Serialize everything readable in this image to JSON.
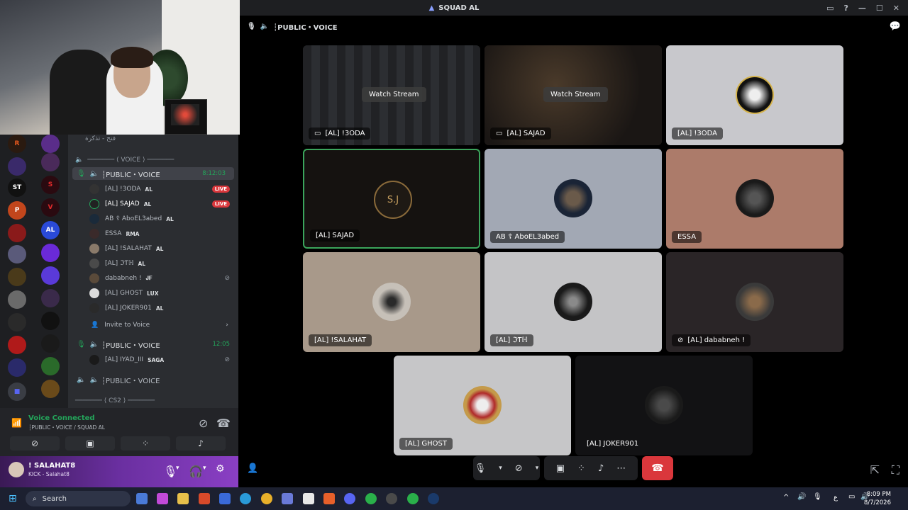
{
  "window": {
    "title": "SQUAD AL"
  },
  "server_rail": {
    "labels": [
      "R",
      "ST",
      "AL"
    ]
  },
  "channels": {
    "top_cut": "فتح - تذكرة",
    "voice_category": "─────── ⟨ VOICE ⟩ ───────",
    "active_channel": "┆PUBLIC・VOICE",
    "active_time": "8:12:03",
    "members": [
      {
        "name": "[AL] !3ODA",
        "tag": "AL",
        "live": "LIVE"
      },
      {
        "name": "[AL] SAJAD",
        "tag": "AL",
        "live": "LIVE"
      },
      {
        "name": "AB ☦ AboEL3abed",
        "tag": "AL",
        "live": ""
      },
      {
        "name": "ESSA",
        "tag": "RMA",
        "live": ""
      },
      {
        "name": "[AL] !SALAHAT",
        "tag": "AL",
        "live": ""
      },
      {
        "name": "[AL] ℑƬℍ",
        "tag": "AL",
        "live": ""
      },
      {
        "name": "dababneh !",
        "tag": "𝐉𝐅",
        "live": ""
      },
      {
        "name": "[AL] GHOST",
        "tag": "LUX",
        "live": ""
      },
      {
        "name": "[AL] JOKER901",
        "tag": "AL",
        "live": ""
      }
    ],
    "invite": "Invite to Voice",
    "channel2": "┆PUBLIC・VOICE",
    "channel2_time": "12:05",
    "channel2_member": "[AL] IYAD_III",
    "channel2_tag": "SAGA",
    "channel3": "┆PUBLIC・VOICE",
    "cs2_category": "─────── ⟨ CS2 ⟩ ───────"
  },
  "voice_panel": {
    "status": "Voice Connected",
    "subtitle": "┆PUBLIC・VOICE / SQUAD AL"
  },
  "user_panel": {
    "name": "! SALAHAT8",
    "status": "KICK - Salahat8"
  },
  "main": {
    "header": "┆PUBLIC・VOICE",
    "tiles": [
      {
        "name": "[AL] !3ODA",
        "watch": "Watch Stream"
      },
      {
        "name": "[AL] SAJAD",
        "watch": "Watch Stream"
      },
      {
        "name": "[AL] !3ODA",
        "watch": ""
      },
      {
        "name": "[AL] SAJAD",
        "watch": ""
      },
      {
        "name": "AB ☦ AboEL3abed",
        "watch": ""
      },
      {
        "name": "ESSA",
        "watch": ""
      },
      {
        "name": "[AL] !SALAHAT",
        "watch": ""
      },
      {
        "name": "[AL] ℑƬℍ",
        "watch": ""
      },
      {
        "name": "[AL] dababneh !",
        "watch": ""
      },
      {
        "name": "[AL] GHOST",
        "watch": ""
      },
      {
        "name": "[AL] JOKER901",
        "watch": ""
      }
    ]
  },
  "taskbar": {
    "search": "Search",
    "time": "8:09 PM",
    "date": "8/7/2026",
    "lang": "ع"
  },
  "colors": {
    "green": "#23a55a",
    "red": "#da373c",
    "blurple": "#5865f2"
  }
}
